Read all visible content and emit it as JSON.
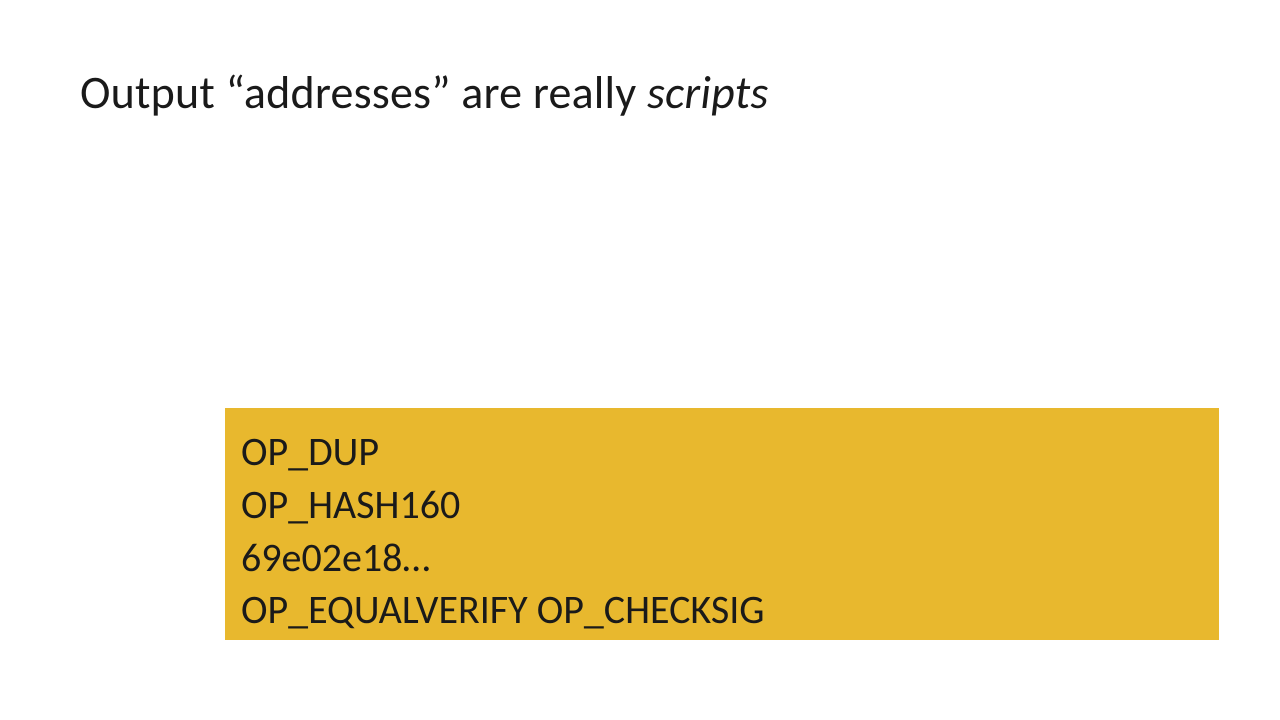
{
  "slide": {
    "title_prefix": "Output “addresses” are really ",
    "title_italic": "scripts"
  },
  "code": {
    "lines": [
      "OP_DUP",
      "OP_HASH160",
      "69e02e18…",
      "OP_EQUALVERIFY OP_CHECKSIG"
    ]
  },
  "colors": {
    "code_box_bg": "#e8b82e",
    "text": "#1a1a1a",
    "background": "#ffffff"
  }
}
